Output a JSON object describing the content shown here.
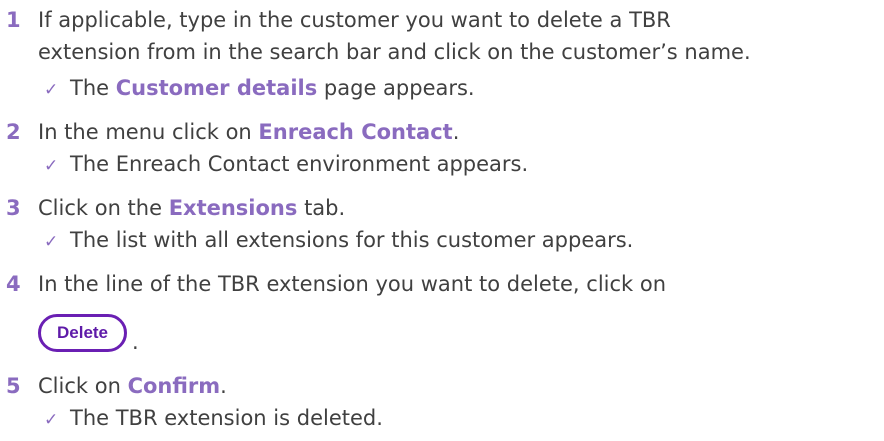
{
  "steps": [
    {
      "number": "1",
      "line1": "If applicable, type in the customer you want to delete a TBR",
      "line2": "extension from in the search bar and click on the customer’s name.",
      "result_pre": "The ",
      "result_highlight": "Customer details",
      "result_post": " page appears."
    },
    {
      "number": "2",
      "pre": "In the menu click on ",
      "highlight": "Enreach Contact",
      "post": ".",
      "result": "The Enreach Contact environment appears."
    },
    {
      "number": "3",
      "pre": "Click on the ",
      "highlight": "Extensions",
      "post": " tab.",
      "result": "The list with all extensions for this customer appears."
    },
    {
      "number": "4",
      "line1": "In the line of the TBR extension you want to delete, click on",
      "button_label": "Delete",
      "trailing": "."
    },
    {
      "number": "5",
      "pre": "Click on ",
      "highlight": "Confirm",
      "post": ".",
      "result": "The TBR extension is deleted."
    }
  ],
  "check_glyph": "✓"
}
